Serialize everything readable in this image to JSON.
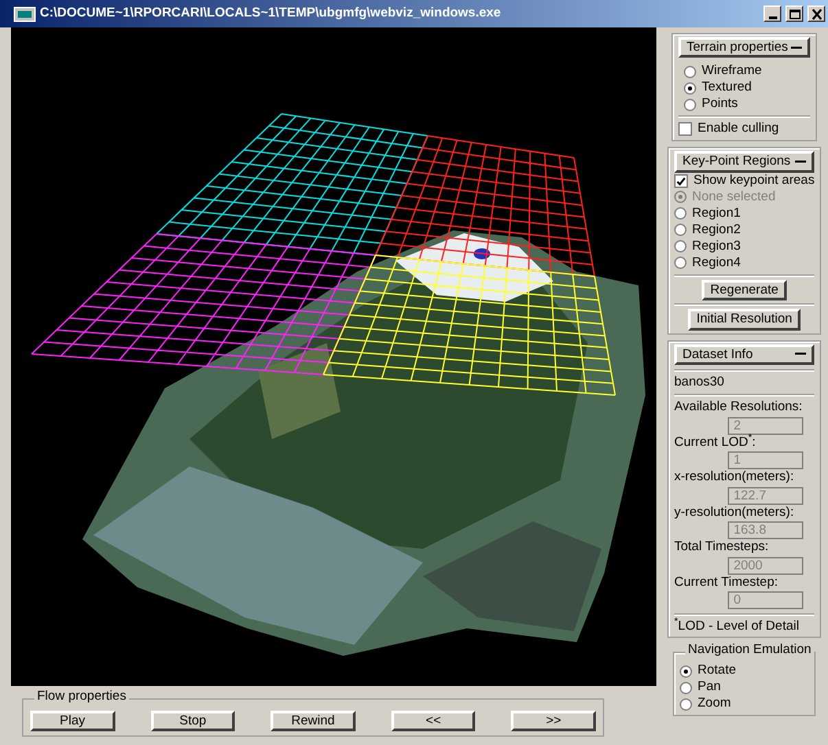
{
  "window": {
    "title": "C:\\DOCUME~1\\RPORCARI\\LOCALS~1\\TEMP\\ubgmfg\\webviz_windows.exe"
  },
  "terrain_properties": {
    "title": "Terrain properties",
    "modes": [
      {
        "label": "Wireframe",
        "selected": false
      },
      {
        "label": "Textured",
        "selected": true
      },
      {
        "label": "Points",
        "selected": false
      }
    ],
    "culling": {
      "label": "Enable culling",
      "checked": false
    }
  },
  "keypoint_regions": {
    "title": "Key-Point Regions",
    "show_areas": {
      "label": "Show keypoint areas",
      "checked": true
    },
    "regions": [
      {
        "label": "None selected",
        "selected": true,
        "disabled": true
      },
      {
        "label": "Region1",
        "selected": false,
        "disabled": false
      },
      {
        "label": "Region2",
        "selected": false,
        "disabled": false
      },
      {
        "label": "Region3",
        "selected": false,
        "disabled": false
      },
      {
        "label": "Region4",
        "selected": false,
        "disabled": false
      }
    ],
    "buttons": [
      "Regenerate",
      "Initial Resolution"
    ]
  },
  "dataset_info": {
    "title": "Dataset Info",
    "name": "banos30",
    "fields": [
      {
        "label": "Available Resolutions:",
        "value": "2"
      },
      {
        "label": "Current LOD$^{*}$:",
        "value": "1"
      },
      {
        "label": "x-resolution(meters):",
        "value": "122.7"
      },
      {
        "label": "y-resolution(meters):",
        "value": "163.8"
      },
      {
        "label": "Total Timesteps:",
        "value": "2000"
      },
      {
        "label": "Current Timestep:",
        "value": "0"
      }
    ],
    "footnote": "$^{*}$LOD - Level of Detail"
  },
  "navigation_emulation": {
    "title": "Navigation Emulation",
    "options": [
      {
        "label": "Rotate",
        "selected": true
      },
      {
        "label": "Pan",
        "selected": false
      },
      {
        "label": "Zoom",
        "selected": false
      }
    ]
  },
  "flow_properties": {
    "title": "Flow properties",
    "buttons": [
      "Play",
      "Stop",
      "Rewind",
      "<<",
      ">>"
    ]
  }
}
